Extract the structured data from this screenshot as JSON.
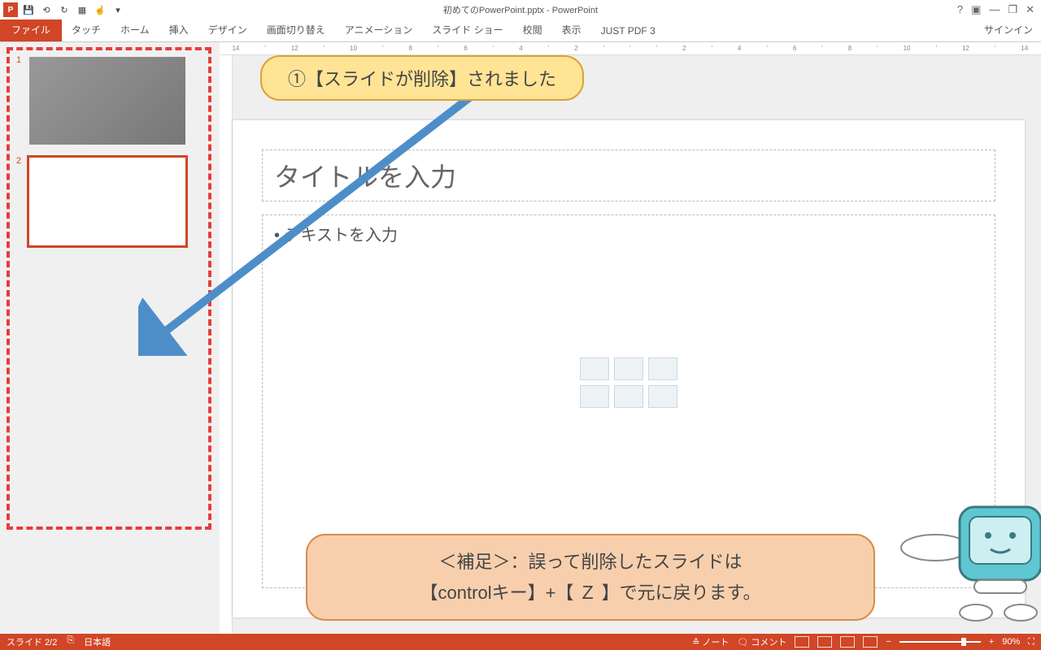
{
  "titlebar": {
    "app_icon": "P",
    "title": "初めてのPowerPoint.pptx - PowerPoint",
    "help": "?",
    "ribbon_toggle": "▣",
    "minimize": "—",
    "restore": "❐",
    "close": "✕"
  },
  "qat": {
    "save": "💾",
    "undo": "⟲",
    "redo": "↻",
    "start": "▦",
    "touch": "☝",
    "dropdown": "▾"
  },
  "ribbon": {
    "file": "ファイル",
    "tabs": [
      "タッチ",
      "ホーム",
      "挿入",
      "デザイン",
      "画面切り替え",
      "アニメーション",
      "スライド ショー",
      "校閲",
      "表示",
      "JUST PDF 3"
    ],
    "signin": "サインイン"
  },
  "thumbs": {
    "n1": "1",
    "n2": "2"
  },
  "slide": {
    "title_placeholder": "タイトルを入力",
    "body_placeholder": "• テキストを入力"
  },
  "callouts": {
    "c1": "①【スライドが削除】されました",
    "c2_line1": "＜補足＞：誤って削除したスライドは",
    "c2_line2": "【controlキー】+【 Ｚ 】で元に戻ります。"
  },
  "ruler": {
    "nums": [
      "14",
      "",
      "12",
      "",
      "",
      "",
      "10",
      "",
      "",
      "",
      "8",
      "",
      "",
      "",
      "6",
      "",
      "",
      "",
      "4",
      "",
      "",
      "",
      "2",
      "",
      "",
      "",
      "",
      "",
      "",
      "",
      "2",
      "",
      "",
      "",
      "4",
      "",
      "",
      "",
      "6",
      "",
      "",
      "",
      "8",
      "",
      "",
      "",
      "10",
      "",
      "",
      "",
      "12",
      "",
      "",
      "",
      "14"
    ]
  },
  "status": {
    "slide_count": "スライド 2/2",
    "lang_icon": "⎘",
    "language": "日本語",
    "notes": "≙ ノート",
    "comments": "🗨 コメント",
    "zoom_minus": "−",
    "zoom_plus": "+",
    "zoom_val": "90%",
    "fit": "⛶"
  }
}
